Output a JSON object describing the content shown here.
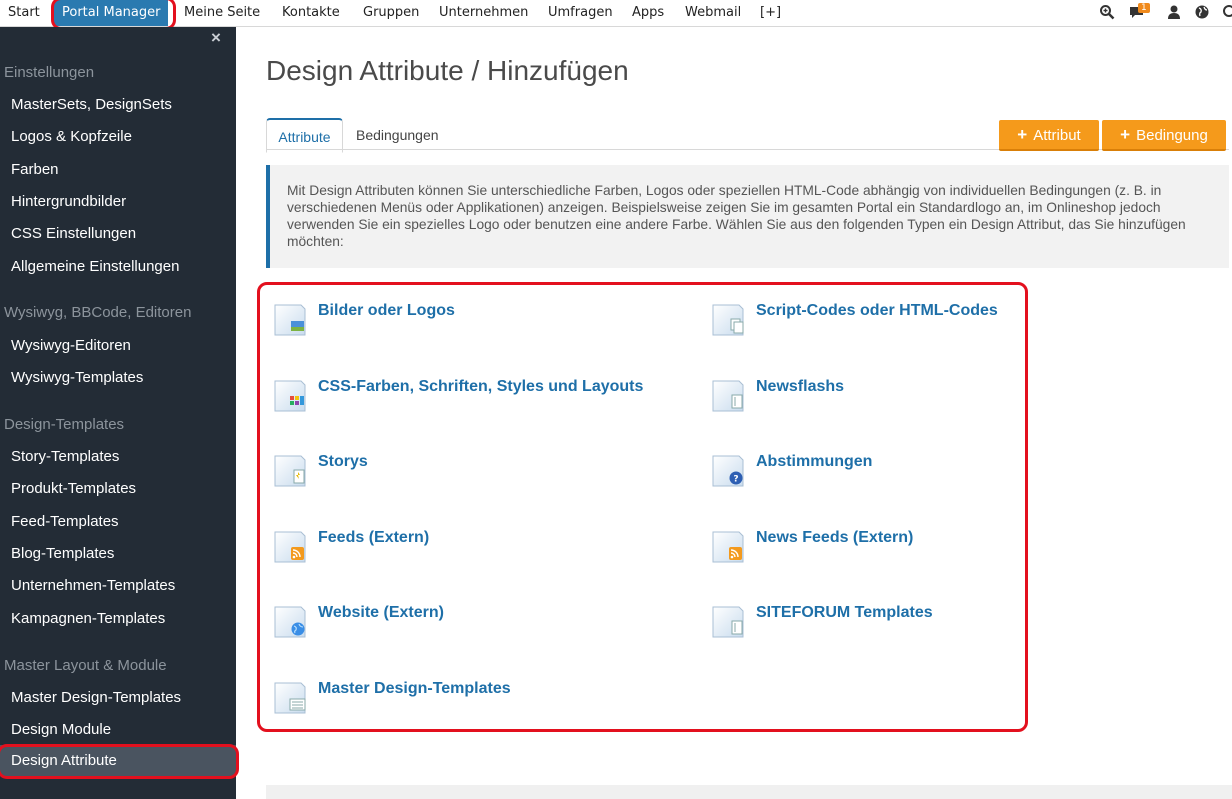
{
  "topbar": {
    "nav": [
      "Start",
      "Portal Manager",
      "Meine Seite",
      "Kontakte",
      "Gruppen",
      "Unternehmen",
      "Umfragen",
      "Apps",
      "Webmail",
      "[+]"
    ],
    "active_index": 1,
    "notification_count": "1",
    "icons": [
      "search-zoom-icon",
      "chat-bubble-icon",
      "user-icon",
      "globe-icon",
      "search-icon"
    ]
  },
  "sidebar": {
    "close_symbol": "×",
    "sections": [
      {
        "title": "Einstellungen",
        "items": [
          "MasterSets, DesignSets",
          "Logos & Kopfzeile",
          "Farben",
          "Hintergrundbilder",
          "CSS Einstellungen",
          "Allgemeine Einstellungen"
        ]
      },
      {
        "title": "Wysiwyg, BBCode, Editoren",
        "items": [
          "Wysiwyg-Editoren",
          "Wysiwyg-Templates"
        ]
      },
      {
        "title": "Design-Templates",
        "items": [
          "Story-Templates",
          "Produkt-Templates",
          "Feed-Templates",
          "Blog-Templates",
          "Unternehmen-Templates",
          "Kampagnen-Templates"
        ]
      },
      {
        "title": "Master Layout & Module",
        "items": [
          "Master Design-Templates",
          "Design Module",
          "Design Attribute"
        ]
      }
    ],
    "selected_item": "Design Attribute"
  },
  "main": {
    "title": "Design Attribute / Hinzufügen",
    "tabs": [
      "Attribute",
      "Bedingungen"
    ],
    "active_tab": "Attribute",
    "buttons": {
      "attribut": "Attribut",
      "bedingung": "Bedingung",
      "plus": "+"
    },
    "info_text": "Mit Design Attributen können Sie unterschiedliche Farben, Logos oder speziellen HTML-Code abhängig von individuellen Bedingungen (z. B. in verschiedenen Menüs oder Applikationen) anzeigen. Beispielsweise zeigen Sie im gesamten Portal ein Standardlogo an, im Onlineshop jedoch verwenden Sie ein spezielles Logo oder benutzen eine andere Farbe. Wählen Sie aus den folgenden Typen ein Design Attribut, das Sie hinzufügen möchten:",
    "types": [
      {
        "label": "Bilder oder Logos",
        "icon": "image-file-icon"
      },
      {
        "label": "Script-Codes oder HTML-Codes",
        "icon": "code-file-icon"
      },
      {
        "label": "CSS-Farben, Schriften, Styles und Layouts",
        "icon": "palette-file-icon"
      },
      {
        "label": "Newsflashs",
        "icon": "newsflash-file-icon"
      },
      {
        "label": "Storys",
        "icon": "story-file-icon"
      },
      {
        "label": "Abstimmungen",
        "icon": "poll-file-icon"
      },
      {
        "label": "Feeds (Extern)",
        "icon": "rss-file-icon"
      },
      {
        "label": "News Feeds (Extern)",
        "icon": "rss-file-icon"
      },
      {
        "label": "Website (Extern)",
        "icon": "globe-file-icon"
      },
      {
        "label": "SITEFORUM Templates",
        "icon": "template-file-icon"
      },
      {
        "label": "Master Design-Templates",
        "icon": "master-template-file-icon"
      }
    ]
  },
  "colors": {
    "accent": "#1e6fa8",
    "orange": "#f59a1b",
    "sidebar_bg": "#232c36",
    "highlight_ring": "#e3101e"
  }
}
